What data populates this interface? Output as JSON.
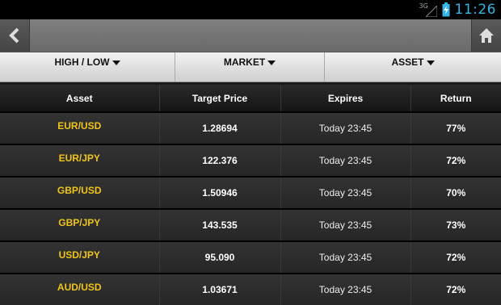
{
  "status_bar": {
    "network_label": "3G",
    "time": "11:26"
  },
  "toolbar": {
    "back_icon": "chevron-left-icon",
    "home_icon": "home-icon"
  },
  "filters": [
    {
      "label": "HIGH / LOW"
    },
    {
      "label": "MARKET"
    },
    {
      "label": "ASSET"
    }
  ],
  "table": {
    "headers": [
      "Asset",
      "Target Price",
      "Expires",
      "Return"
    ],
    "rows": [
      {
        "asset": "EUR/USD",
        "price": "1.28694",
        "expires": "Today 23:45",
        "return": "77%"
      },
      {
        "asset": "EUR/JPY",
        "price": "122.376",
        "expires": "Today 23:45",
        "return": "72%"
      },
      {
        "asset": "GBP/USD",
        "price": "1.50946",
        "expires": "Today 23:45",
        "return": "70%"
      },
      {
        "asset": "GBP/JPY",
        "price": "143.535",
        "expires": "Today 23:45",
        "return": "73%"
      },
      {
        "asset": "USD/JPY",
        "price": "95.090",
        "expires": "Today 23:45",
        "return": "72%"
      },
      {
        "asset": "AUD/USD",
        "price": "1.03671",
        "expires": "Today 23:45",
        "return": "72%"
      }
    ]
  },
  "colors": {
    "asset_text": "#f0c419",
    "clock": "#33b5e5"
  }
}
